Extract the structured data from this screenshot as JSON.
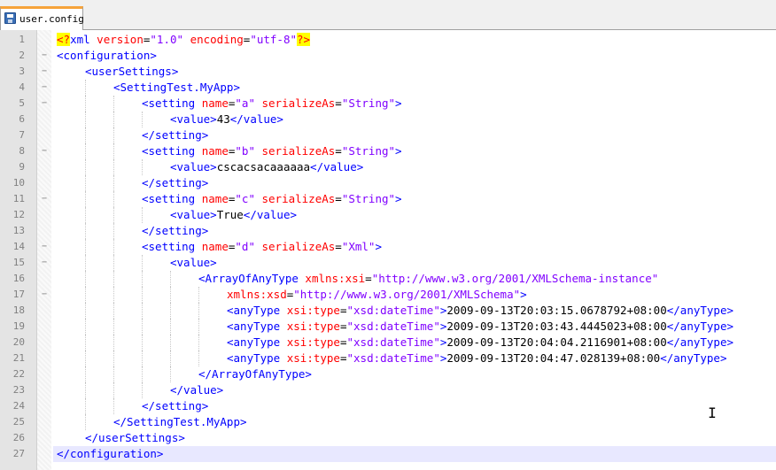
{
  "tab": {
    "label": "user.config",
    "icon": "save-file-icon"
  },
  "lines": [
    {
      "num": "1",
      "fold": "",
      "indent": 0,
      "current": false,
      "tokens": [
        {
          "t": "pi",
          "s": "<?"
        },
        {
          "t": "tag",
          "s": "xml"
        },
        {
          "t": "text",
          "s": " "
        },
        {
          "t": "attr",
          "s": "version"
        },
        {
          "t": "text",
          "s": "="
        },
        {
          "t": "val",
          "s": "\"1.0\""
        },
        {
          "t": "text",
          "s": " "
        },
        {
          "t": "attr",
          "s": "encoding"
        },
        {
          "t": "text",
          "s": "="
        },
        {
          "t": "val",
          "s": "\"utf-8\""
        },
        {
          "t": "pi",
          "s": "?>"
        }
      ]
    },
    {
      "num": "2",
      "fold": "−",
      "indent": 0,
      "current": false,
      "tokens": [
        {
          "t": "tag",
          "s": "<configuration>"
        }
      ]
    },
    {
      "num": "3",
      "fold": "−",
      "indent": 1,
      "current": false,
      "tokens": [
        {
          "t": "tag",
          "s": "<userSettings>"
        }
      ]
    },
    {
      "num": "4",
      "fold": "−",
      "indent": 2,
      "current": false,
      "tokens": [
        {
          "t": "tag",
          "s": "<SettingTest.MyApp>"
        }
      ]
    },
    {
      "num": "5",
      "fold": "−",
      "indent": 3,
      "current": false,
      "tokens": [
        {
          "t": "tag",
          "s": "<setting"
        },
        {
          "t": "text",
          "s": " "
        },
        {
          "t": "attr",
          "s": "name"
        },
        {
          "t": "text",
          "s": "="
        },
        {
          "t": "val",
          "s": "\"a\""
        },
        {
          "t": "text",
          "s": " "
        },
        {
          "t": "attr",
          "s": "serializeAs"
        },
        {
          "t": "text",
          "s": "="
        },
        {
          "t": "val",
          "s": "\"String\""
        },
        {
          "t": "tag",
          "s": ">"
        }
      ]
    },
    {
      "num": "6",
      "fold": "",
      "indent": 4,
      "current": false,
      "tokens": [
        {
          "t": "tag",
          "s": "<value>"
        },
        {
          "t": "text",
          "s": "43"
        },
        {
          "t": "tag",
          "s": "</value>"
        }
      ]
    },
    {
      "num": "7",
      "fold": "",
      "indent": 3,
      "current": false,
      "tokens": [
        {
          "t": "tag",
          "s": "</setting>"
        }
      ]
    },
    {
      "num": "8",
      "fold": "−",
      "indent": 3,
      "current": false,
      "tokens": [
        {
          "t": "tag",
          "s": "<setting"
        },
        {
          "t": "text",
          "s": " "
        },
        {
          "t": "attr",
          "s": "name"
        },
        {
          "t": "text",
          "s": "="
        },
        {
          "t": "val",
          "s": "\"b\""
        },
        {
          "t": "text",
          "s": " "
        },
        {
          "t": "attr",
          "s": "serializeAs"
        },
        {
          "t": "text",
          "s": "="
        },
        {
          "t": "val",
          "s": "\"String\""
        },
        {
          "t": "tag",
          "s": ">"
        }
      ]
    },
    {
      "num": "9",
      "fold": "",
      "indent": 4,
      "current": false,
      "tokens": [
        {
          "t": "tag",
          "s": "<value>"
        },
        {
          "t": "text",
          "s": "cscacsacaaaaaa"
        },
        {
          "t": "tag",
          "s": "</value>"
        }
      ]
    },
    {
      "num": "10",
      "fold": "",
      "indent": 3,
      "current": false,
      "tokens": [
        {
          "t": "tag",
          "s": "</setting>"
        }
      ]
    },
    {
      "num": "11",
      "fold": "−",
      "indent": 3,
      "current": false,
      "tokens": [
        {
          "t": "tag",
          "s": "<setting"
        },
        {
          "t": "text",
          "s": " "
        },
        {
          "t": "attr",
          "s": "name"
        },
        {
          "t": "text",
          "s": "="
        },
        {
          "t": "val",
          "s": "\"c\""
        },
        {
          "t": "text",
          "s": " "
        },
        {
          "t": "attr",
          "s": "serializeAs"
        },
        {
          "t": "text",
          "s": "="
        },
        {
          "t": "val",
          "s": "\"String\""
        },
        {
          "t": "tag",
          "s": ">"
        }
      ]
    },
    {
      "num": "12",
      "fold": "",
      "indent": 4,
      "current": false,
      "tokens": [
        {
          "t": "tag",
          "s": "<value>"
        },
        {
          "t": "text",
          "s": "True"
        },
        {
          "t": "tag",
          "s": "</value>"
        }
      ]
    },
    {
      "num": "13",
      "fold": "",
      "indent": 3,
      "current": false,
      "tokens": [
        {
          "t": "tag",
          "s": "</setting>"
        }
      ]
    },
    {
      "num": "14",
      "fold": "−",
      "indent": 3,
      "current": false,
      "tokens": [
        {
          "t": "tag",
          "s": "<setting"
        },
        {
          "t": "text",
          "s": " "
        },
        {
          "t": "attr",
          "s": "name"
        },
        {
          "t": "text",
          "s": "="
        },
        {
          "t": "val",
          "s": "\"d\""
        },
        {
          "t": "text",
          "s": " "
        },
        {
          "t": "attr",
          "s": "serializeAs"
        },
        {
          "t": "text",
          "s": "="
        },
        {
          "t": "val",
          "s": "\"Xml\""
        },
        {
          "t": "tag",
          "s": ">"
        }
      ]
    },
    {
      "num": "15",
      "fold": "−",
      "indent": 4,
      "current": false,
      "tokens": [
        {
          "t": "tag",
          "s": "<value>"
        }
      ]
    },
    {
      "num": "16",
      "fold": "",
      "indent": 5,
      "current": false,
      "tokens": [
        {
          "t": "tag",
          "s": "<ArrayOfAnyType"
        },
        {
          "t": "text",
          "s": " "
        },
        {
          "t": "attr",
          "s": "xmlns:xsi"
        },
        {
          "t": "text",
          "s": "="
        },
        {
          "t": "val",
          "s": "\"http://www.w3.org/2001/XMLSchema-instance\""
        }
      ]
    },
    {
      "num": "17",
      "fold": "−",
      "indent": 6,
      "current": false,
      "tokens": [
        {
          "t": "attr",
          "s": "xmlns:xsd"
        },
        {
          "t": "text",
          "s": "="
        },
        {
          "t": "val",
          "s": "\"http://www.w3.org/2001/XMLSchema\""
        },
        {
          "t": "tag",
          "s": ">"
        }
      ]
    },
    {
      "num": "18",
      "fold": "",
      "indent": 6,
      "current": false,
      "tokens": [
        {
          "t": "tag",
          "s": "<anyType"
        },
        {
          "t": "text",
          "s": " "
        },
        {
          "t": "attr",
          "s": "xsi:type"
        },
        {
          "t": "text",
          "s": "="
        },
        {
          "t": "val",
          "s": "\"xsd:dateTime\""
        },
        {
          "t": "tag",
          "s": ">"
        },
        {
          "t": "text",
          "s": "2009-09-13T20:03:15.0678792+08:00"
        },
        {
          "t": "tag",
          "s": "</anyType>"
        }
      ]
    },
    {
      "num": "19",
      "fold": "",
      "indent": 6,
      "current": false,
      "tokens": [
        {
          "t": "tag",
          "s": "<anyType"
        },
        {
          "t": "text",
          "s": " "
        },
        {
          "t": "attr",
          "s": "xsi:type"
        },
        {
          "t": "text",
          "s": "="
        },
        {
          "t": "val",
          "s": "\"xsd:dateTime\""
        },
        {
          "t": "tag",
          "s": ">"
        },
        {
          "t": "text",
          "s": "2009-09-13T20:03:43.4445023+08:00"
        },
        {
          "t": "tag",
          "s": "</anyType>"
        }
      ]
    },
    {
      "num": "20",
      "fold": "",
      "indent": 6,
      "current": false,
      "tokens": [
        {
          "t": "tag",
          "s": "<anyType"
        },
        {
          "t": "text",
          "s": " "
        },
        {
          "t": "attr",
          "s": "xsi:type"
        },
        {
          "t": "text",
          "s": "="
        },
        {
          "t": "val",
          "s": "\"xsd:dateTime\""
        },
        {
          "t": "tag",
          "s": ">"
        },
        {
          "t": "text",
          "s": "2009-09-13T20:04:04.2116901+08:00"
        },
        {
          "t": "tag",
          "s": "</anyType>"
        }
      ]
    },
    {
      "num": "21",
      "fold": "",
      "indent": 6,
      "current": false,
      "tokens": [
        {
          "t": "tag",
          "s": "<anyType"
        },
        {
          "t": "text",
          "s": " "
        },
        {
          "t": "attr",
          "s": "xsi:type"
        },
        {
          "t": "text",
          "s": "="
        },
        {
          "t": "val",
          "s": "\"xsd:dateTime\""
        },
        {
          "t": "tag",
          "s": ">"
        },
        {
          "t": "text",
          "s": "2009-09-13T20:04:47.028139+08:00"
        },
        {
          "t": "tag",
          "s": "</anyType>"
        }
      ]
    },
    {
      "num": "22",
      "fold": "",
      "indent": 5,
      "current": false,
      "tokens": [
        {
          "t": "tag",
          "s": "</ArrayOfAnyType>"
        }
      ]
    },
    {
      "num": "23",
      "fold": "",
      "indent": 4,
      "current": false,
      "tokens": [
        {
          "t": "tag",
          "s": "</value>"
        }
      ]
    },
    {
      "num": "24",
      "fold": "",
      "indent": 3,
      "current": false,
      "tokens": [
        {
          "t": "tag",
          "s": "</setting>"
        }
      ]
    },
    {
      "num": "25",
      "fold": "",
      "indent": 2,
      "current": false,
      "tokens": [
        {
          "t": "tag",
          "s": "</SettingTest.MyApp>"
        }
      ]
    },
    {
      "num": "26",
      "fold": "",
      "indent": 1,
      "current": false,
      "tokens": [
        {
          "t": "tag",
          "s": "</userSettings>"
        }
      ]
    },
    {
      "num": "27",
      "fold": "",
      "indent": 0,
      "current": true,
      "tokens": [
        {
          "t": "tag",
          "s": "</configuration>"
        }
      ]
    }
  ],
  "colors": {
    "tag": "#0000ff",
    "attr": "#ff0000",
    "value": "#8000ff",
    "text": "#000000",
    "pi_bg": "#ffff00",
    "current_line": "#e8e8ff",
    "tab_accent": "#f6a33a"
  },
  "cursor": "text-cursor-icon"
}
